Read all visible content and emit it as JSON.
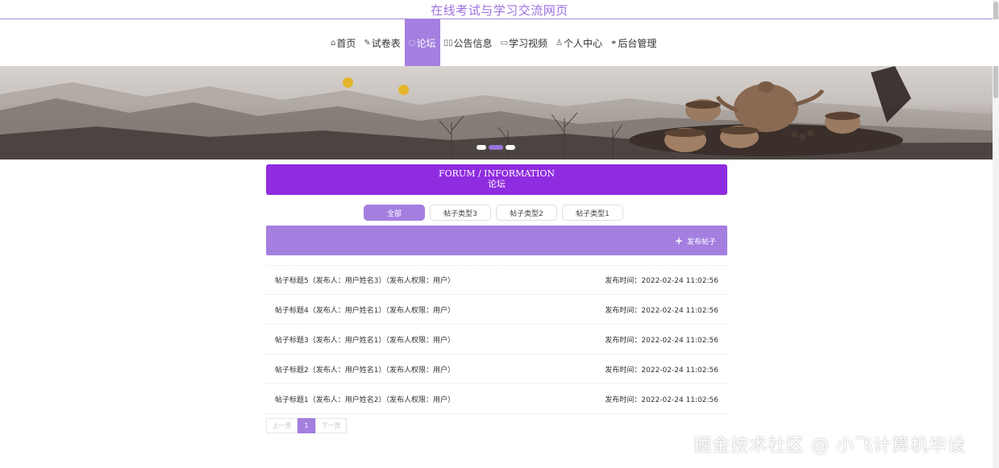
{
  "site": {
    "title": "在线考试与学习交流网页"
  },
  "nav": {
    "items": [
      {
        "icon": "home-icon",
        "glyph": "⌂",
        "label": "首页",
        "active": false
      },
      {
        "icon": "tag-icon",
        "glyph": "✎",
        "label": "试卷表",
        "active": false
      },
      {
        "icon": "forum-icon",
        "glyph": "◌",
        "label": "论坛",
        "active": true
      },
      {
        "icon": "notice-icon",
        "glyph": "▯▯",
        "label": "公告信息",
        "active": false
      },
      {
        "icon": "video-icon",
        "glyph": "▭",
        "label": "学习视频",
        "active": false
      },
      {
        "icon": "user-icon",
        "glyph": "♙",
        "label": "个人中心",
        "active": false
      },
      {
        "icon": "link-icon",
        "glyph": "⚭",
        "label": "后台管理",
        "active": false
      }
    ]
  },
  "banner": {
    "slide_count": 3,
    "active_slide": 2
  },
  "section": {
    "title_en": "FORUM / INFORMATION",
    "title_cn": "论坛"
  },
  "filters": {
    "tabs": [
      {
        "label": "全部",
        "active": true
      },
      {
        "label": "帖子类型3",
        "active": false
      },
      {
        "label": "帖子类型2",
        "active": false
      },
      {
        "label": "帖子类型1",
        "active": false
      }
    ]
  },
  "actions": {
    "post_label": "发布帖子",
    "post_icon": "plus-icon"
  },
  "posts": [
    {
      "title": "帖子标题5（发布人：用户姓名3）（发布人权限：用户）",
      "time": "发布时间：2022-02-24 11:02:56"
    },
    {
      "title": "帖子标题4（发布人：用户姓名1）（发布人权限：用户）",
      "time": "发布时间：2022-02-24 11:02:56"
    },
    {
      "title": "帖子标题3（发布人：用户姓名1）（发布人权限：用户）",
      "time": "发布时间：2022-02-24 11:02:56"
    },
    {
      "title": "帖子标题2（发布人：用户姓名1）（发布人权限：用户）",
      "time": "发布时间：2022-02-24 11:02:56"
    },
    {
      "title": "帖子标题1（发布人：用户姓名2）（发布人权限：用户）",
      "time": "发布时间：2022-02-24 11:02:56"
    }
  ],
  "pagination": {
    "prev": "上一页",
    "current": "1",
    "next": "下一页"
  },
  "watermark": "掘金技术社区 @ 小飞计算机毕设",
  "colors": {
    "accent": "#a47fe0",
    "header": "#8f2ce0",
    "title": "#9b6ee0"
  }
}
